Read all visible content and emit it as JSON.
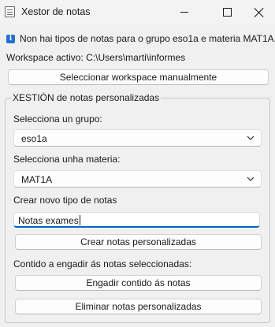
{
  "window": {
    "title": "Xestor de notas"
  },
  "info": {
    "message": "Non hai tipos de notas para o grupo eso1a e materia MAT1A.",
    "icon": "info-icon"
  },
  "workspace": {
    "label": "Workspace activo: C:\\Users\\marti\\informes",
    "select_button": "Seleccionar workspace manualmente"
  },
  "group": {
    "title": "XESTIÓN de notas personalizadas",
    "grupo_label": "Selecciona un grupo:",
    "grupo_value": "eso1a",
    "materia_label": "Selecciona unha materia:",
    "materia_value": "MAT1A",
    "new_type_label": "Crear novo tipo de notas",
    "new_type_value": "Notas exames",
    "create_button": "Crear notas personalizadas",
    "content_label": "Contido a engadir ás notas seleccionadas:",
    "add_button": "Engadir contido ás notas",
    "delete_button": "Eliminar notas personalizadas"
  },
  "colors": {
    "accent": "#0067c0",
    "info": "#1e6fd9"
  }
}
